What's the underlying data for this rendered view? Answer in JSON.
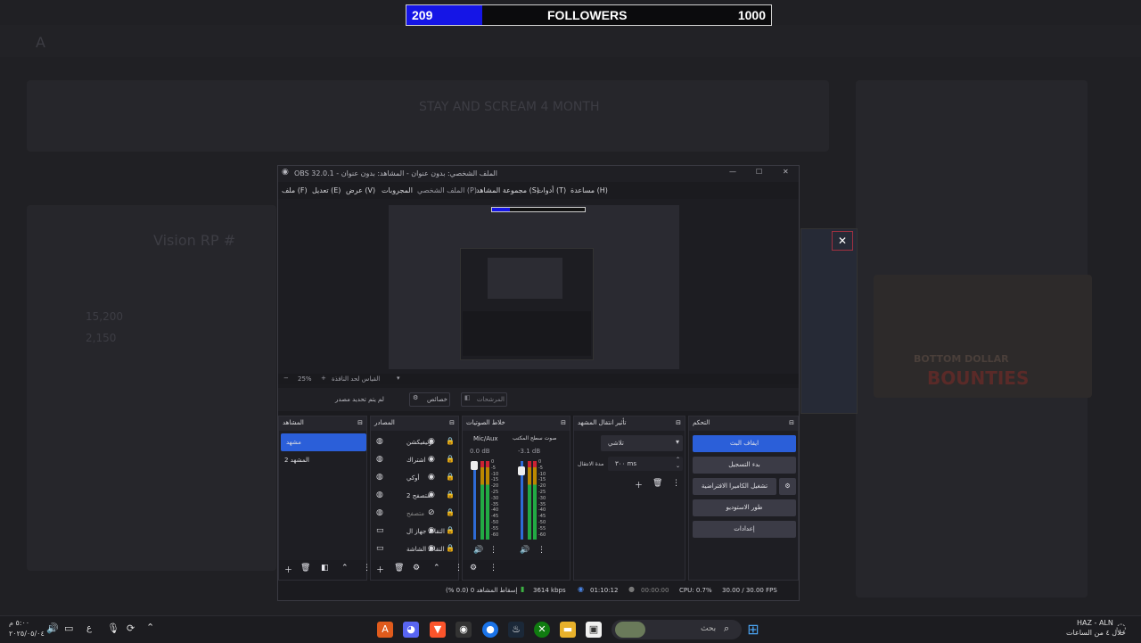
{
  "followers": {
    "current": "209",
    "label": "FOLLOWERS",
    "goal": "1000",
    "progress_fraction": 0.209
  },
  "background_page": {
    "channel_title": "Vision RP #",
    "stat1": "15,200",
    "stat2": "2,150",
    "video_title": "STAY AND SCREAM 4 MONTH",
    "banner_line1": "BOTTOM DOLLAR",
    "banner_line2": "BOUNTIES"
  },
  "obs": {
    "title": "OBS 32.0.1 - الملف الشخصي: بدون عنوان - المشاهد: بدون عنوان",
    "menu": [
      "ملف (F)",
      "تعديل (E)",
      "عرض (V)",
      "الملف الشخصي (P)",
      "المجروبات",
      "مجموعة المشاهد (S)",
      "أدوات (T)",
      "مساعدة (H)"
    ],
    "zoom": "25%",
    "zoom_mode": "القياس لحد النافذة",
    "context": {
      "no_source": "لم يتم تحديد مصدر",
      "properties": "خصائص",
      "filters": "المرشحات"
    },
    "docks": {
      "scenes": {
        "title": "المشاهد",
        "items": [
          "مشهد",
          "المشهد 2"
        ]
      },
      "sources": {
        "title": "المصادر",
        "items": [
          "نوتيفيكشن",
          "اشتراك",
          "أوكي",
          "متصفح 2",
          "متصفح",
          "التقاط جهاز ال",
          "التقاط الشاشة"
        ]
      },
      "mixer": {
        "title": "خلاط الصوتيات",
        "channels": [
          {
            "name": "Mic/Aux",
            "db": "0.0 dB"
          },
          {
            "name": "صوت سطح المكتب",
            "db": "-3.1 dB"
          }
        ],
        "scale": [
          "0",
          "-5",
          "-10",
          "-15",
          "-20",
          "-25",
          "-30",
          "-35",
          "-40",
          "-45",
          "-50",
          "-55",
          "-60"
        ]
      },
      "transitions": {
        "title": "تأثير انتقال المشهد",
        "type": "تلاشي",
        "duration_label": "مدة الانتقال",
        "duration": "٣٠٠ ms"
      },
      "controls": {
        "title": "التحكم",
        "buttons": [
          "ايقاف البث",
          "بدء التسجيل",
          "تشغيل الكاميرا الافتراضية",
          "طور الاستوديو",
          "إعدادات"
        ]
      }
    },
    "status": {
      "dropped": "إسقاط المشاهد 0 (0.0 %)",
      "bitrate": "3614 kbps",
      "stream_time": "01:10:12",
      "rec_time": "00:00:00",
      "cpu": "CPU: 0.7%",
      "fps": "30.00 / 30.00 FPS"
    }
  },
  "taskbar": {
    "search": "بحث",
    "clock_time": "٥:٠٠ م",
    "clock_date": "٢٠٢٥/٠٥/٠٤",
    "lang": "ع",
    "weather": "HAZ - ALN",
    "weather_sub": "خلال ٤ من الساعات"
  },
  "colors": {
    "accent": "#2b5fd9",
    "obs_bg": "#1b1b1f",
    "follower_fill": "#1515e6"
  }
}
